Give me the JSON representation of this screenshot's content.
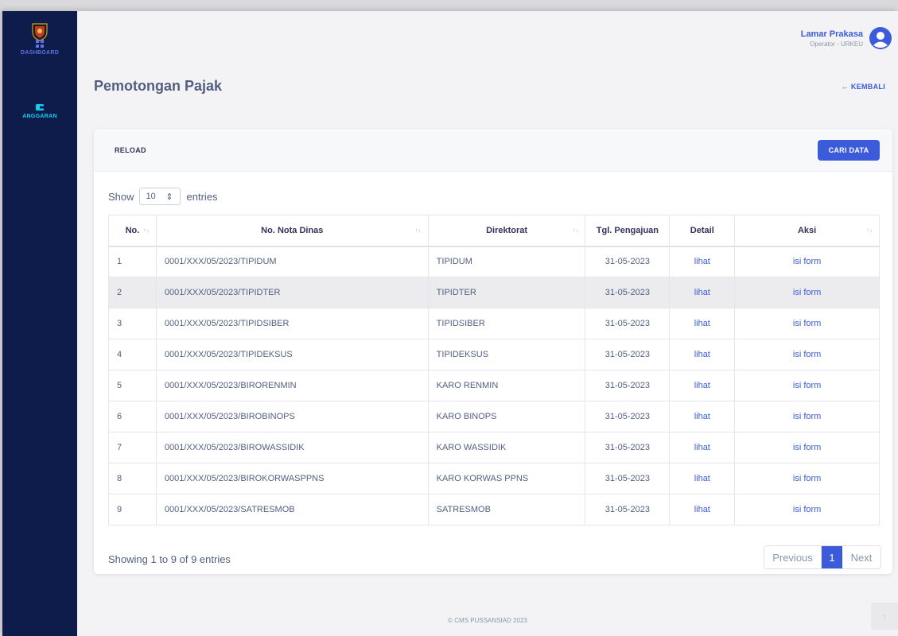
{
  "sidebar": {
    "items": [
      {
        "label": "DASHBOARD",
        "icon": "grid-icon"
      },
      {
        "label": "ANGGARAN",
        "icon": "wallet-icon"
      }
    ]
  },
  "user": {
    "name": "Lamar Prakasa",
    "role": "Operator - URKEU",
    "icon": "user-circle-icon"
  },
  "page": {
    "title": "Pemotongan Pajak",
    "back_label": "← KEMBALI"
  },
  "card": {
    "reload_label": "RELOAD",
    "search_button_label": "CARI DATA",
    "show_label": "Show",
    "entries_value": "10",
    "entries_label": "entries"
  },
  "table": {
    "columns": [
      "No.",
      "No. Nota Dinas",
      "Direktorat",
      "Tgl. Pengajuan",
      "Detail",
      "Aksi"
    ],
    "rows": [
      {
        "no": "1",
        "nota": "0001/XXX/05/2023/TIPIDUM",
        "direktorat": "TIPIDUM",
        "tgl": "31-05-2023",
        "detail": "lihat",
        "aksi": "isi form"
      },
      {
        "no": "2",
        "nota": "0001/XXX/05/2023/TIPIDTER",
        "direktorat": "TIPIDTER",
        "tgl": "31-05-2023",
        "detail": "lihat",
        "aksi": "isi form"
      },
      {
        "no": "3",
        "nota": "0001/XXX/05/2023/TIPIDSIBER",
        "direktorat": "TIPIDSIBER",
        "tgl": "31-05-2023",
        "detail": "lihat",
        "aksi": "isi form"
      },
      {
        "no": "4",
        "nota": "0001/XXX/05/2023/TIPIDEKSUS",
        "direktorat": "TIPIDEKSUS",
        "tgl": "31-05-2023",
        "detail": "lihat",
        "aksi": "isi form"
      },
      {
        "no": "5",
        "nota": "0001/XXX/05/2023/BIRORENMIN",
        "direktorat": "KARO RENMIN",
        "tgl": "31-05-2023",
        "detail": "lihat",
        "aksi": "isi form"
      },
      {
        "no": "6",
        "nota": "0001/XXX/05/2023/BIROBINOPS",
        "direktorat": "KARO BINOPS",
        "tgl": "31-05-2023",
        "detail": "lihat",
        "aksi": "isi form"
      },
      {
        "no": "7",
        "nota": "0001/XXX/05/2023/BIROWASSIDIK",
        "direktorat": "KARO WASSIDIK",
        "tgl": "31-05-2023",
        "detail": "lihat",
        "aksi": "isi form"
      },
      {
        "no": "8",
        "nota": "0001/XXX/05/2023/BIROKORWASPPNS",
        "direktorat": "KARO KORWAS PPNS",
        "tgl": "31-05-2023",
        "detail": "lihat",
        "aksi": "isi form"
      },
      {
        "no": "9",
        "nota": "0001/XXX/05/2023/SATRESMOB",
        "direktorat": "SATRESMOB",
        "tgl": "31-05-2023",
        "detail": "lihat",
        "aksi": "isi form"
      }
    ]
  },
  "pagination": {
    "info": "Showing 1 to 9 of 9 entries",
    "previous": "Previous",
    "current": "1",
    "next": "Next"
  },
  "footer": {
    "text": "© CMS PUSSANSIAD 2023"
  },
  "colors": {
    "sidebar": "#0d1c4b",
    "accent": "#3b5bdb",
    "cyan": "#11cdef"
  }
}
